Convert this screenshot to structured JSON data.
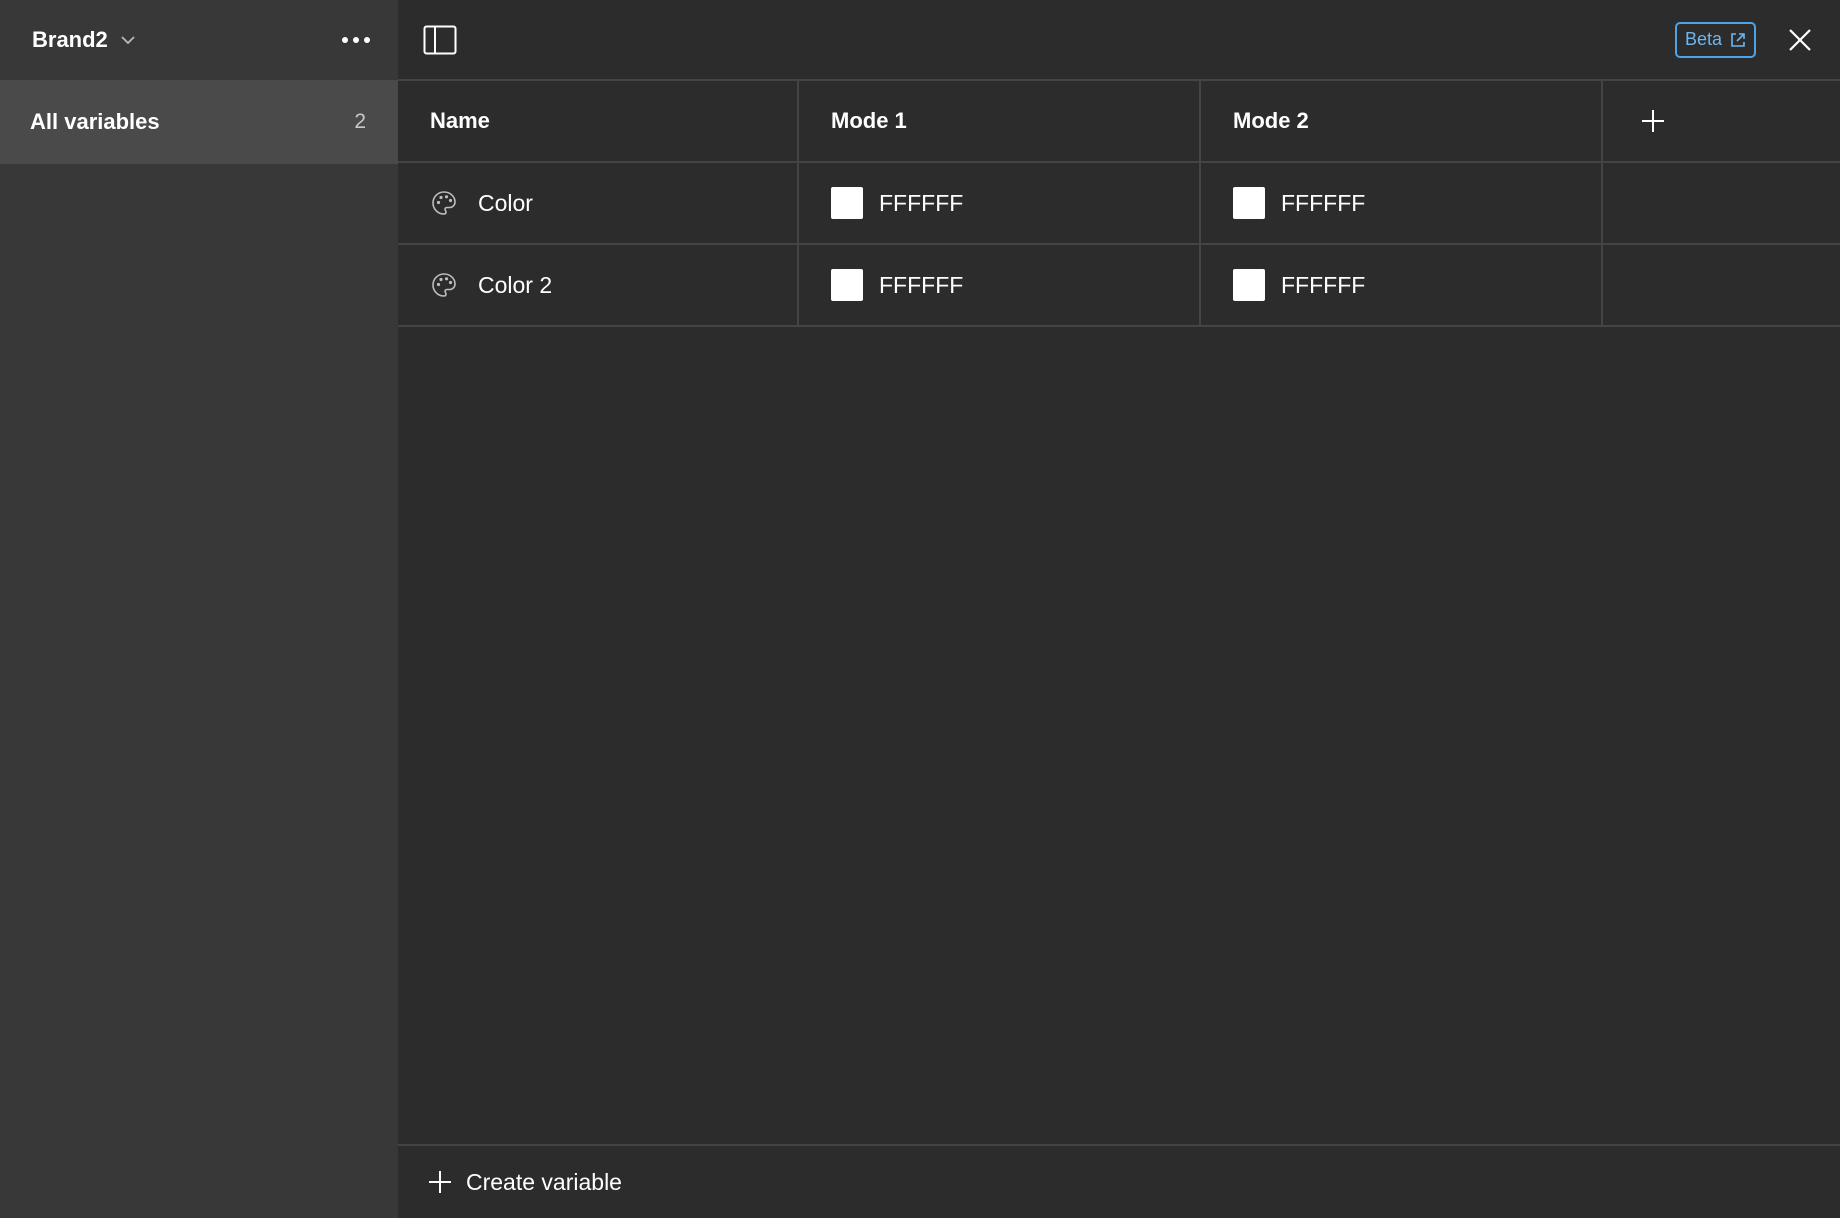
{
  "sidebar": {
    "collection_name": "Brand2",
    "items": [
      {
        "label": "All variables",
        "count": "2"
      }
    ]
  },
  "topbar": {
    "beta_label": "Beta"
  },
  "table": {
    "headers": {
      "name": "Name",
      "modes": [
        "Mode 1",
        "Mode 2"
      ]
    },
    "rows": [
      {
        "name": "Color",
        "icon": "palette-icon",
        "values": [
          {
            "hex": "FFFFFF",
            "swatch": "#FFFFFF"
          },
          {
            "hex": "FFFFFF",
            "swatch": "#FFFFFF"
          }
        ]
      },
      {
        "name": "Color 2",
        "icon": "palette-icon",
        "values": [
          {
            "hex": "FFFFFF",
            "swatch": "#FFFFFF"
          },
          {
            "hex": "FFFFFF",
            "swatch": "#FFFFFF"
          }
        ]
      }
    ]
  },
  "footer": {
    "create_label": "Create variable"
  },
  "colors": {
    "sidebar_bg": "#383838",
    "selected_item_bg": "#4a4a4a",
    "main_bg": "#2c2c2c",
    "accent": "#4da3e8"
  }
}
